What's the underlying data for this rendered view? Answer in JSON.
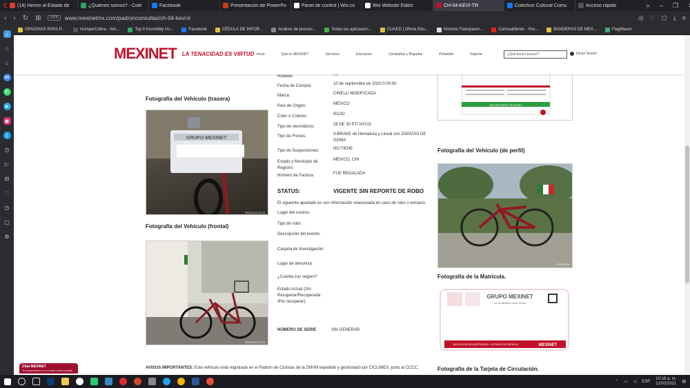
{
  "browser": {
    "tabs": [
      {
        "label": "(14) Himno al Estado de",
        "color": "#e03c31",
        "active": false
      },
      {
        "label": "¿Quiénes somos? - Cole",
        "color": "#2ea36b",
        "active": false
      },
      {
        "label": "Facebook",
        "color": "#1877f2",
        "active": false
      },
      {
        "label": "Presentación de PowerPo",
        "color": "#c43e1c",
        "active": false
      },
      {
        "label": "Panel de control | Wix.co",
        "color": "#ffffff",
        "active": false
      },
      {
        "label": "Wix Website Editor",
        "color": "#ffffff",
        "active": false
      },
      {
        "label": "CH-04-KEVI-TR",
        "color": "#c2122a",
        "active": true
      },
      {
        "label": "Colectivo Cultural Comu",
        "color": "#1877f2",
        "active": false
      },
      {
        "label": "Acceso rápido",
        "color": "#555555",
        "active": false
      }
    ],
    "vpn_label": "VPN",
    "url": "www.mexinetmx.com/padronconsultas/ch-04-kevi-tr",
    "bookmarks": [
      {
        "label": "OPAGINAS PARA P...",
        "color": "#e0c040"
      },
      {
        "label": "HumperCobra - Inic...",
        "color": "#555"
      },
      {
        "label": "Top 8 Incredibly Us...",
        "color": "#3a6"
      },
      {
        "label": "Facebook",
        "color": "#1877f2"
      },
      {
        "label": "CÉDULA DE INFOR...",
        "color": "#e0c040"
      },
      {
        "label": "Análisis de precios...",
        "color": "#888"
      },
      {
        "label": "Todas las aplicacion...",
        "color": "#4caf50"
      },
      {
        "label": "CUAED | Oferta Edu...",
        "color": "#e0c040"
      },
      {
        "label": "Nómina Transparen...",
        "color": "#ddd"
      },
      {
        "label": "CuriosaMente - You...",
        "color": "#e62117"
      },
      {
        "label": "BANDERAS DE MEX...",
        "color": "#e0c040"
      },
      {
        "label": "FlagWaver",
        "color": "#4a7"
      }
    ]
  },
  "site": {
    "logo": "MEXINET",
    "tagline": "LA TENACIDAD ES VIRTUD",
    "nav": [
      "Inicio",
      "Qué es MEXINET",
      "Servicios",
      "Educación",
      "Campañas y Brigadas",
      "Portafolio",
      "Soporte"
    ],
    "search_placeholder": "¿Qué tienes buscar?",
    "login": "Iniciar Sesión"
  },
  "captions": {
    "rear": "Fotografía del Vehículo (trasera)",
    "front": "Fotografía del Vehículo (frontal)",
    "profile": "Fotografía del Vehículo (de perfil)",
    "plate": "Fotografía de la Matrícula.",
    "card": "Fotografía de la Tarjeta de Circulación."
  },
  "photo_text": {
    "plate_card_title": "GRUPO MEXINET",
    "plate_card_sub": "La Tenacidad como Virtud",
    "plate_footer": "BICICLETA DE ASISTENCIA · ESTADO DE MÉXICO",
    "rear_stamp": "2021/1/13 21:43",
    "front_stamp": "2021/1/13 21:43",
    "profile_stamp": "2021/1/13",
    "doc_banner": "SIN REPORTE DE ROBO"
  },
  "fields": [
    {
      "label": "Rodada:",
      "value": "26"
    },
    {
      "label": "Fecha de Compra:",
      "value": "10 de septiembre de 2020 0:00:00"
    },
    {
      "label": "Marca:",
      "value": "CINELLI MODIFICADA"
    },
    {
      "label": "País de Origen:",
      "value": "MÉXICO"
    },
    {
      "label": "Color o Colores:",
      "value": "ROJO"
    },
    {
      "label": "Tipo de neumáticos:",
      "value": "26 DE 30 PTI NYCO"
    },
    {
      "label": "Tipo de Frenos:",
      "value": "V-BRAKE de Herradura y Lineal con ZAPATAS DE GOMA"
    },
    {
      "label": "Tipo de Suspensiones:",
      "value": "NO TIENE"
    },
    {
      "label": "Estado y Municipio de Registro:",
      "value": "MÉXICO, CHI"
    },
    {
      "label": "Número de Factura:",
      "value": "FUE REGALADA"
    }
  ],
  "status": {
    "label": "STATUS:",
    "value": "VIGENTE SIN REPORTE DE ROBO"
  },
  "note": "El siguiente apartado es con información relacionada en caso de robo o extravío.",
  "theft_fields": [
    "Lugar del suceso:",
    "Tipo de robo:",
    "Descripción del evento:",
    "Carpeta de Investigación:",
    "Lugar de denuncia:",
    "¿Cuenta con seguro?",
    "Estado Actual (Sin Recuperar/Recuperada /Por recuperar):"
  ],
  "serial": {
    "label": "NÚMERO DE SERIE",
    "value": "SIN GENERAR"
  },
  "avisos": {
    "label": "AVISOS IMPORTANTES:",
    "text": "Este vehículo está registrado en el Padrón de Ciclistas de la ZMVM expedido y gestionado por CICLIMEX, junto al CCCC,"
  },
  "chat": {
    "title": "Chat MEXINET",
    "sub": "Te respondemos en cuanto antes posible"
  },
  "taskbar": {
    "lang": "ESP",
    "time": "10:16 a. m.",
    "date": "12/02/2021"
  }
}
